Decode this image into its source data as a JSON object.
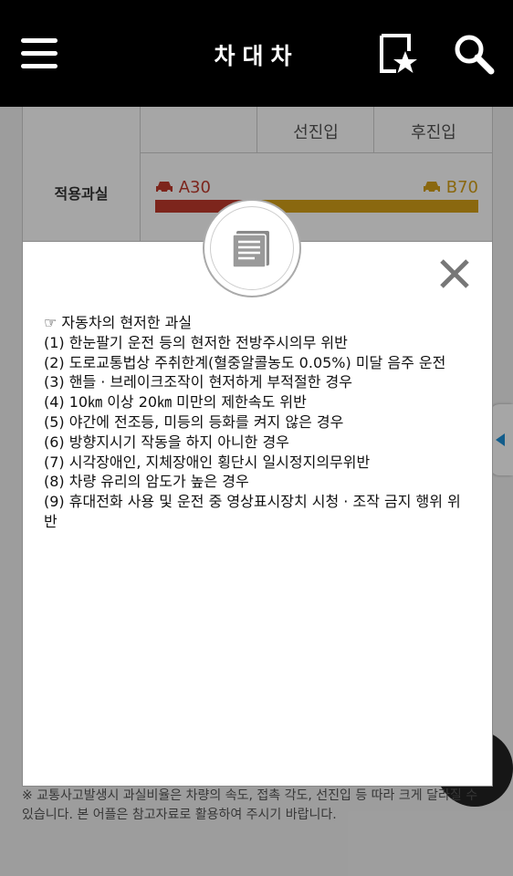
{
  "header": {
    "title": "차대차"
  },
  "table": {
    "col_headers": [
      "",
      "선진입",
      "후진입"
    ],
    "row_label": "적용과실",
    "fault_a": "A30",
    "fault_b": "B70",
    "fault_a_value": 30,
    "fault_b_value": 70,
    "colors": {
      "a": "#c0392b",
      "b": "#d4a017"
    }
  },
  "modal": {
    "heading": "☞ 자동차의 현저한 과실",
    "items": [
      "(1) 한눈팔기 운전 등의 현저한 전방주시의무 위반",
      "(2) 도로교통법상 주취한계(혈중알콜농도 0.05%) 미달 음주 운전",
      "(3) 핸들 · 브레이크조작이 현저하게 부적절한 경우",
      "(4) 10㎞ 이상 20㎞ 미만의 제한속도 위반",
      "(5) 야간에 전조등, 미등의 등화를 켜지 않은 경우",
      "(6) 방향지시기 작동을 하지 아니한 경우",
      "(7) 시각장애인, 지체장애인 횡단시 일시정지의무위반",
      "(8) 차량 유리의 암도가 높은 경우",
      "(9) 휴대전화 사용 및 운전 중 영상표시장치 시청 · 조작 금지 행위 위반"
    ]
  },
  "footnote": "※ 교통사고발생시 과실비율은 차량의 속도, 접촉 각도, 선진입 등 따라 크게 달라질 수 있습니다. 본 어플은 참고자료로 활용하여 주시기 바랍니다.",
  "icons": {
    "menu": "menu-icon",
    "bookmark": "bookmark-star-icon",
    "search": "search-icon",
    "book": "book-icon",
    "close": "close-icon",
    "car": "car-icon",
    "handle": "arrow-left-icon"
  }
}
